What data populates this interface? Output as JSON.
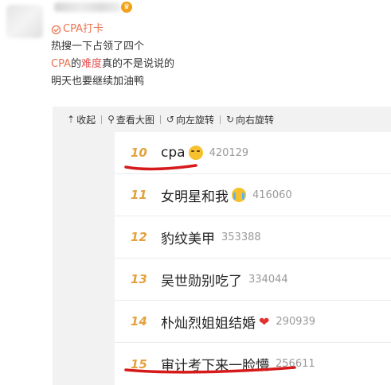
{
  "post": {
    "topic_tag": "CPA打卡",
    "line1": "热搜一下占领了四个",
    "line2_parts": [
      "CPA",
      "的",
      "难度",
      "真的不是说说的"
    ],
    "line3": "明天也要继续加油鸭"
  },
  "toolbar": {
    "items": [
      {
        "icon": "⇡",
        "label": "收起"
      },
      {
        "icon": "⚲",
        "label": "查看大图"
      },
      {
        "icon": "↺",
        "label": "向左旋转"
      },
      {
        "icon": "↻",
        "label": "向右旋转"
      }
    ]
  },
  "hot_list": [
    {
      "rank": "10",
      "title": "cpa",
      "emoji": "laugh",
      "count": "420129"
    },
    {
      "rank": "11",
      "title": "女明星和我",
      "emoji": "cry",
      "count": "416060"
    },
    {
      "rank": "12",
      "title": "豹纹美甲",
      "emoji": "",
      "count": "353388"
    },
    {
      "rank": "13",
      "title": "吴世勋别吃了",
      "emoji": "",
      "count": "334044"
    },
    {
      "rank": "14",
      "title": "朴灿烈姐姐结婚",
      "emoji": "heart",
      "count": "290939"
    },
    {
      "rank": "15",
      "title": "审计考下来一脸懵",
      "emoji": "",
      "count": "256611"
    }
  ],
  "colors": {
    "rank": "#e3a23f",
    "topic": "#eb7350",
    "highlight": "#e64e4e",
    "annotation": "#d61a1a"
  }
}
